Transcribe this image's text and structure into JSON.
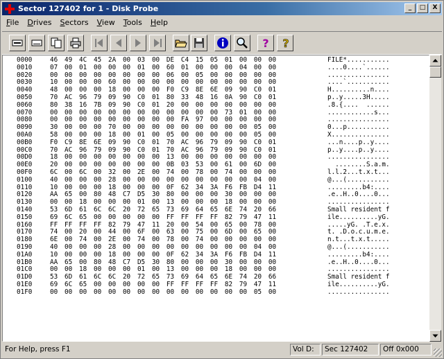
{
  "window": {
    "title": "Sector 127402 for 1 - Disk Probe",
    "min_label": "_",
    "max_label": "□",
    "close_label": "X"
  },
  "menu": [
    {
      "label": "File",
      "ul": "F",
      "rest": "ile"
    },
    {
      "label": "Drives",
      "ul": "D",
      "rest": "rives"
    },
    {
      "label": "Sectors",
      "ul": "S",
      "rest": "ectors"
    },
    {
      "label": "View",
      "ul": "V",
      "rest": "iew"
    },
    {
      "label": "Tools",
      "ul": "T",
      "rest": "ools"
    },
    {
      "label": "Help",
      "ul": "H",
      "rest": "elp"
    }
  ],
  "toolbar": {
    "icons": [
      "read-icon",
      "write-icon",
      "copy-icon",
      "print-icon",
      "first-sector-icon",
      "previous-sector-icon",
      "next-sector-icon",
      "last-sector-icon",
      "open-icon",
      "save-icon",
      "info-icon",
      "search-icon",
      "help-icon",
      "context-help-icon"
    ]
  },
  "hex_rows": [
    {
      "off": "0000",
      "hex": "46 49 4C 45 2A 00 03 00 DE C4 15 05 01 00 00 00",
      "asc": "FILE*..........."
    },
    {
      "off": "0010",
      "hex": "07 00 01 00 00 00 01 00 60 01 00 00 00 04 00 00",
      "asc": "....0....`......"
    },
    {
      "off": "0020",
      "hex": "00 00 00 00 00 00 00 00 06 00 05 00 00 00 00 00",
      "asc": "................"
    },
    {
      "off": "0030",
      "hex": "10 00 00 00 60 00 00 00 00 00 00 00 00 00 00 00",
      "asc": "....`..........."
    },
    {
      "off": "0040",
      "hex": "48 00 00 00 18 00 00 00 F0 C9 8E 6E 09 90 C0 01",
      "asc": "H..........n...."
    },
    {
      "off": "0050",
      "hex": "70 AC 96 79 09 90 C0 01 80 33 48 16 0A 90 C0 01",
      "asc": "p..y.....3H....."
    },
    {
      "off": "0060",
      "hex": "80 38 16 7B 09 90 C0 01 20 00 00 00 00 00 00 00",
      "asc": ".8.{....  ......"
    },
    {
      "off": "0070",
      "hex": "00 00 00 00 00 00 00 00 00 00 00 00 73 01 00 00",
      "asc": "............s..."
    },
    {
      "off": "0080",
      "hex": "00 00 00 00 00 00 00 00 00 FA 97 00 00 00 00 00",
      "asc": "................"
    },
    {
      "off": "0090",
      "hex": "30 00 00 00 70 00 00 00 00 00 00 00 00 00 05 00",
      "asc": "0...p..........."
    },
    {
      "off": "00A0",
      "hex": "58 00 00 00 18 00 01 00 05 00 00 00 00 00 05 00",
      "asc": "X..............."
    },
    {
      "off": "00B0",
      "hex": "F0 C9 8E 6E 09 90 C0 01 70 AC 96 79 09 90 C0 01",
      "asc": "...n....p..y...."
    },
    {
      "off": "00C0",
      "hex": "70 AC 96 79 09 90 C0 01 70 AC 96 79 09 90 C0 01",
      "asc": "p..y....p..y...."
    },
    {
      "off": "00D0",
      "hex": "18 00 00 00 00 00 00 00 13 00 00 00 00 00 00 00",
      "asc": "................"
    },
    {
      "off": "00E0",
      "hex": "20 00 00 00 00 00 00 00 0B 03 53 00 61 00 6D 00",
      "asc": "  ........S.a.m."
    },
    {
      "off": "00F0",
      "hex": "6C 00 6C 00 32 00 2E 00 74 00 78 00 74 00 00 00",
      "asc": "l.l.2...t.x.t..."
    },
    {
      "off": "0100",
      "hex": "40 00 00 00 28 00 00 00 00 00 00 00 00 00 04 00",
      "asc": "@...(..........."
    },
    {
      "off": "0110",
      "hex": "10 00 00 00 18 00 00 00 0F 62 34 3A F6 FB D4 11",
      "asc": ".........b4:...."
    },
    {
      "off": "0120",
      "hex": "AA 65 00 80 48 C7 D5 30 80 00 00 00 30 00 00 00",
      "asc": ".e..H..0....0..."
    },
    {
      "off": "0130",
      "hex": "00 00 18 00 00 00 01 00 13 00 00 00 18 00 00 00",
      "asc": "................"
    },
    {
      "off": "0140",
      "hex": "53 6D 61 6C 6C 20 72 65 73 69 64 65 6E 74 20 66",
      "asc": "Small resident f"
    },
    {
      "off": "0150",
      "hex": "69 6C 65 00 00 00 00 00 FF FF FF FF 82 79 47 11",
      "asc": "ile..........yG."
    },
    {
      "off": "0160",
      "hex": "FF FF FF FF 82 79 47 11 20 00 54 00 65 00 78 00",
      "asc": ".....yG. .T.e.x."
    },
    {
      "off": "0170",
      "hex": "74 00 20 00 44 00 6F 00 63 00 75 00 6D 00 65 00",
      "asc": "t. .D.o.c.u.m.e."
    },
    {
      "off": "0180",
      "hex": "6E 00 74 00 2E 00 74 00 78 00 74 00 00 00 00 00",
      "asc": "n.t...t.x.t....."
    },
    {
      "off": "0190",
      "hex": "40 00 00 00 28 00 00 00 00 00 00 00 00 00 04 00",
      "asc": "@...(..........."
    },
    {
      "off": "01A0",
      "hex": "10 00 00 00 18 00 00 00 0F 62 34 3A F6 FB D4 11",
      "asc": ".........b4:...."
    },
    {
      "off": "01B0",
      "hex": "AA 65 00 80 48 C7 D5 30 80 00 00 00 30 00 00 00",
      "asc": ".e..H..0....0..."
    },
    {
      "off": "01C0",
      "hex": "00 00 18 00 00 00 01 00 13 00 00 00 18 00 00 00",
      "asc": "................"
    },
    {
      "off": "01D0",
      "hex": "53 6D 61 6C 6C 20 72 65 73 69 64 65 6E 74 20 66",
      "asc": "Small resident f"
    },
    {
      "off": "01E0",
      "hex": "69 6C 65 00 00 00 00 00 FF FF FF FF 82 79 47 11",
      "asc": "ile..........yG."
    },
    {
      "off": "01F0",
      "hex": "00 00 00 00 00 00 00 00 00 00 00 00 00 00 05 00",
      "asc": "................"
    }
  ],
  "status": {
    "help": "For Help, press F1",
    "vol": "Vol  D:",
    "sec": "Sec 127402",
    "off": "Off 0x000"
  }
}
